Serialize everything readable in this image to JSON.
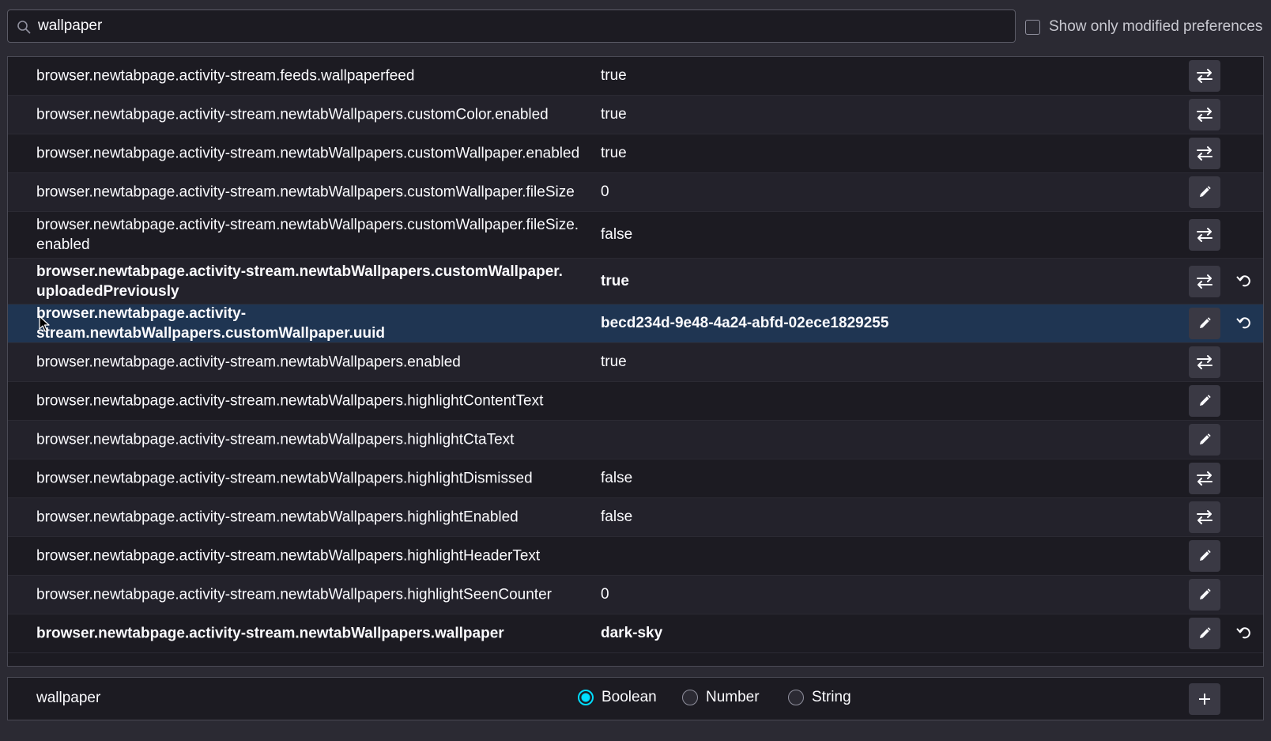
{
  "search": {
    "value": "wallpaper",
    "placeholder": "Search preference name"
  },
  "modified_filter": {
    "label": "Show only modified preferences",
    "checked": false
  },
  "preferences": [
    {
      "name": "browser.newtabpage.activity-stream.feeds.wallpaperfeed",
      "value": "true",
      "action": "toggle",
      "modified": false
    },
    {
      "name": "browser.newtabpage.activity-stream.newtabWallpapers.customColor.enabled",
      "value": "true",
      "action": "toggle",
      "modified": false
    },
    {
      "name": "browser.newtabpage.activity-stream.newtabWallpapers.customWallpaper.enabled",
      "value": "true",
      "action": "toggle",
      "modified": false
    },
    {
      "name": "browser.newtabpage.activity-stream.newtabWallpapers.customWallpaper.fileSize",
      "value": "0",
      "action": "edit",
      "modified": false
    },
    {
      "name": "browser.newtabpage.activity-stream.newtabWallpapers.customWallpaper.fileSize.​enabled",
      "value": "false",
      "action": "toggle",
      "modified": false
    },
    {
      "name": "browser.newtabpage.activity-stream.newtabWallpapers.customWallpaper.​uploadedPreviously",
      "value": "true",
      "action": "toggle",
      "modified": true
    },
    {
      "name": "browser.newtabpage.activity-stream.newtabWallpapers.customWallpaper.uuid",
      "value": "becd234d-9e48-4a24-abfd-02ece1829255",
      "action": "edit",
      "modified": true,
      "selected": true
    },
    {
      "name": "browser.newtabpage.activity-stream.newtabWallpapers.enabled",
      "value": "true",
      "action": "toggle",
      "modified": false
    },
    {
      "name": "browser.newtabpage.activity-stream.newtabWallpapers.highlightContentText",
      "value": "",
      "action": "edit",
      "modified": false
    },
    {
      "name": "browser.newtabpage.activity-stream.newtabWallpapers.highlightCtaText",
      "value": "",
      "action": "edit",
      "modified": false
    },
    {
      "name": "browser.newtabpage.activity-stream.newtabWallpapers.highlightDismissed",
      "value": "false",
      "action": "toggle",
      "modified": false
    },
    {
      "name": "browser.newtabpage.activity-stream.newtabWallpapers.highlightEnabled",
      "value": "false",
      "action": "toggle",
      "modified": false
    },
    {
      "name": "browser.newtabpage.activity-stream.newtabWallpapers.highlightHeaderText",
      "value": "",
      "action": "edit",
      "modified": false
    },
    {
      "name": "browser.newtabpage.activity-stream.newtabWallpapers.highlightSeenCounter",
      "value": "0",
      "action": "edit",
      "modified": false
    },
    {
      "name": "browser.newtabpage.activity-stream.newtabWallpapers.wallpaper",
      "value": "dark-sky",
      "action": "edit",
      "modified": true
    }
  ],
  "add_pref": {
    "name": "wallpaper",
    "types": [
      {
        "label": "Boolean",
        "checked": true
      },
      {
        "label": "Number",
        "checked": false
      },
      {
        "label": "String",
        "checked": false
      }
    ]
  },
  "icons": {
    "search": "search-icon",
    "toggle": "toggle-arrows-icon",
    "edit": "pencil-icon",
    "reset": "reset-icon",
    "add": "plus-icon",
    "cursor": "mouse-pointer-icon"
  },
  "colors": {
    "accent": "#00ddff",
    "selected_row": "#1f3552",
    "background": "#1c1b22"
  }
}
